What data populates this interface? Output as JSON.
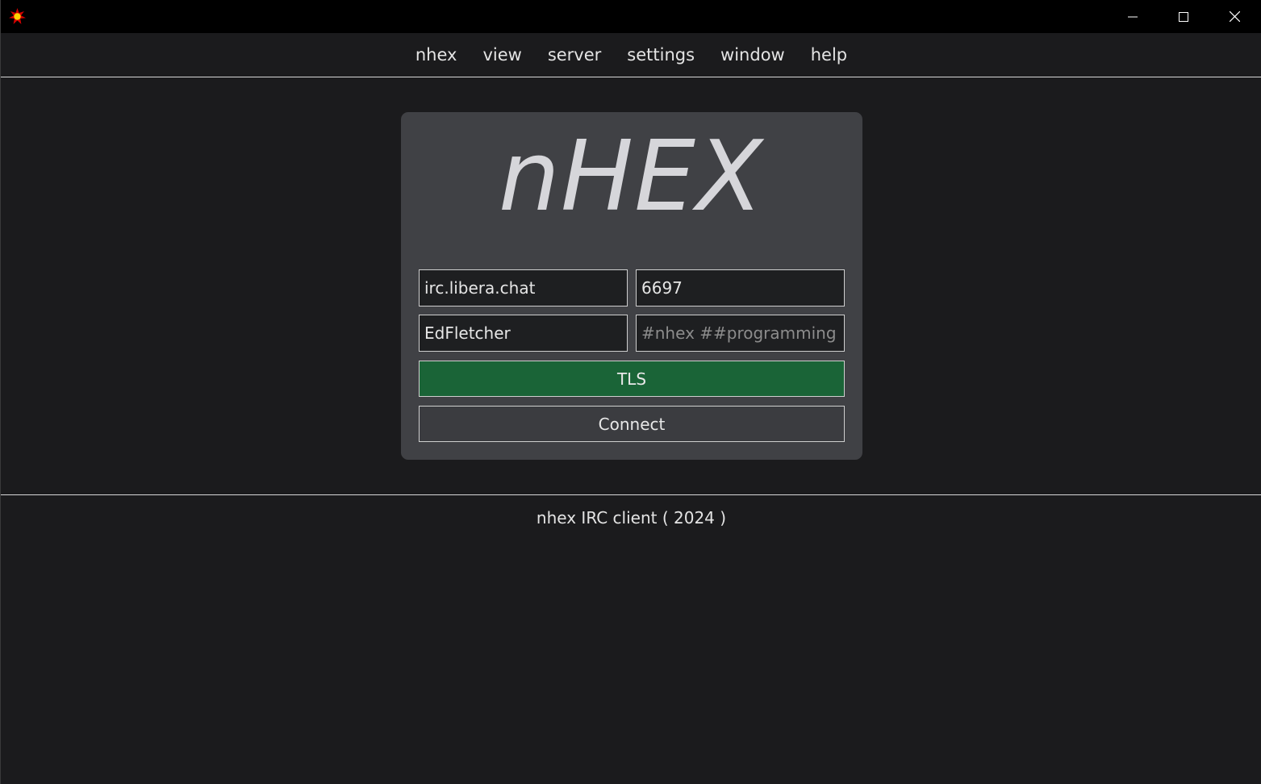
{
  "titlebar": {
    "app_icon": "nhex-star-icon",
    "controls": {
      "minimize_icon": "minimize-icon",
      "maximize_icon": "maximize-icon",
      "close_icon": "close-icon"
    }
  },
  "menu": {
    "items": [
      {
        "label": "nhex"
      },
      {
        "label": "view"
      },
      {
        "label": "server"
      },
      {
        "label": "settings"
      },
      {
        "label": "window"
      },
      {
        "label": "help"
      }
    ]
  },
  "connect_card": {
    "logo": "nHEX",
    "server_field": {
      "value": "irc.libera.chat",
      "placeholder": ""
    },
    "port_field": {
      "value": "6697",
      "placeholder": ""
    },
    "nick_field": {
      "value": "EdFletcher",
      "placeholder": ""
    },
    "channels_field": {
      "value": "",
      "placeholder": "#nhex ##programming"
    },
    "tls_button": {
      "label": "TLS",
      "color": "#1a6437"
    },
    "connect_button": {
      "label": "Connect"
    }
  },
  "footer": {
    "text": "nhex IRC client ( 2024 )"
  },
  "colors": {
    "background": "#1b1b1d",
    "card": "#404145",
    "accent_green": "#1a6437"
  }
}
